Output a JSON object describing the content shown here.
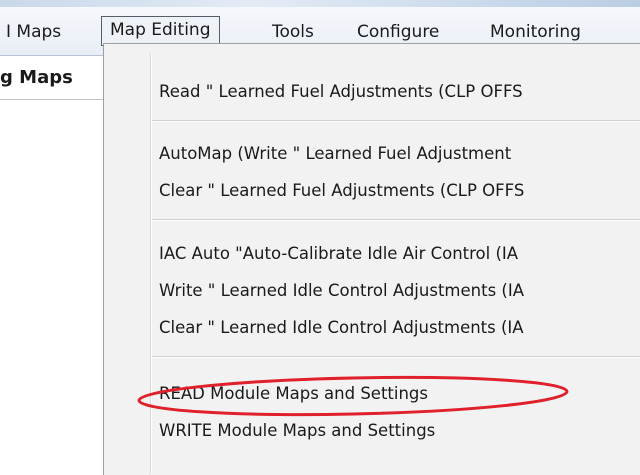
{
  "menubar": {
    "items": [
      {
        "label": "I Maps"
      },
      {
        "label": "Map Editing"
      },
      {
        "label": "Tools"
      },
      {
        "label": "Configure"
      },
      {
        "label": "Monitoring"
      }
    ]
  },
  "left_panel": {
    "tab_label": "g Maps"
  },
  "dropdown": {
    "items": [
      {
        "label": "Read  \" Learned Fuel Adjustments (CLP OFFS"
      },
      {
        "label": "AutoMap  (Write  \" Learned Fuel Adjustment"
      },
      {
        "label": "Clear  \" Learned Fuel Adjustments (CLP OFFS"
      },
      {
        "label": "IAC Auto \"Auto-Calibrate Idle Air Control (IA"
      },
      {
        "label": "Write  \" Learned Idle Control Adjustments (IA"
      },
      {
        "label": "Clear  \" Learned Idle Control Adjustments (IA"
      },
      {
        "label": "READ Module Maps and Settings"
      },
      {
        "label": "WRITE Module Maps and Settings"
      }
    ]
  },
  "colors": {
    "highlight_ring": "#e0202a",
    "menu_active_border": "#555d68"
  }
}
